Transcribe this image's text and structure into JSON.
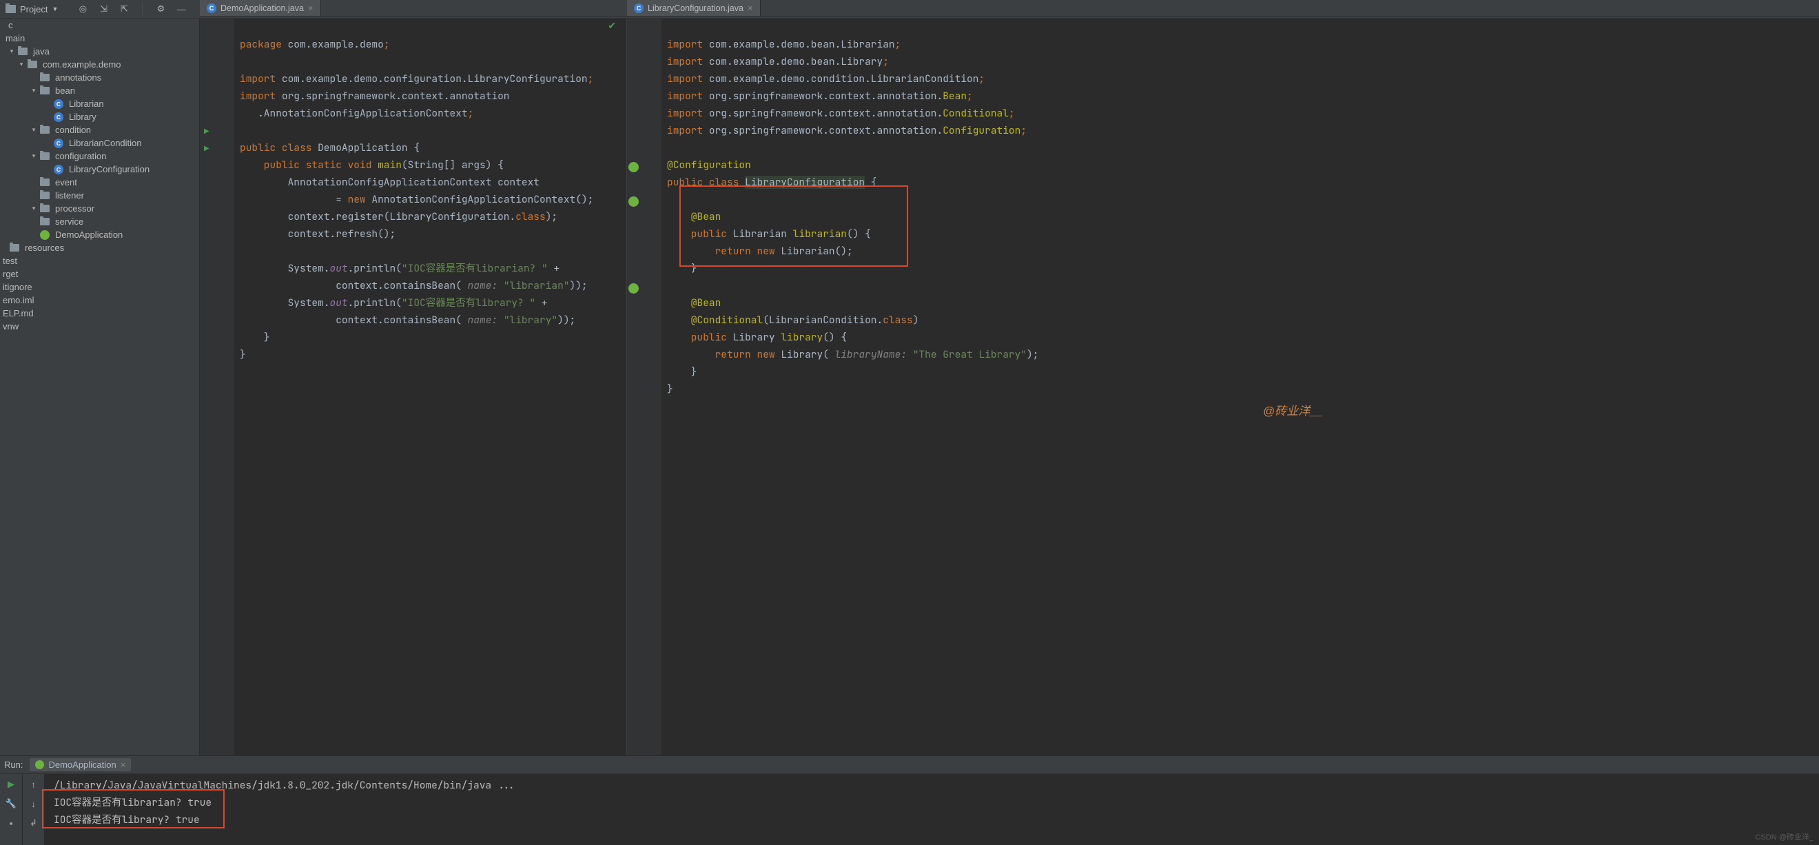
{
  "toolbar": {
    "project_label": "Project"
  },
  "tabs": {
    "left": {
      "label": "DemoApplication.java"
    },
    "right": {
      "label": "LibraryConfiguration.java"
    }
  },
  "tree": {
    "c": "c",
    "main": "main",
    "java": "java",
    "pkg": "com.example.demo",
    "annotations": "annotations",
    "bean": "bean",
    "librarian": "Librarian",
    "library": "Library",
    "condition": "condition",
    "librarian_condition": "LibrarianCondition",
    "configuration": "configuration",
    "library_configuration": "LibraryConfiguration",
    "event": "event",
    "listener": "listener",
    "processor": "processor",
    "service": "service",
    "demo_application": "DemoApplication",
    "resources": "resources",
    "test": "test",
    "rget": "rget",
    "itignore": "itignore",
    "emo_iml": "emo.iml",
    "elp_md": "ELP.md",
    "vnw": "vnw"
  },
  "code_left": {
    "l1a": "package ",
    "l1b": "com.example.demo",
    "l1c": ";",
    "l3a": "import ",
    "l3b": "com.example.demo.configuration.LibraryConfiguration",
    "l3c": ";",
    "l4a": "import ",
    "l4b": "org.springframework.context.annotation",
    "l5a": "   .AnnotationConfigApplicationContext",
    "l5b": ";",
    "l7a": "public class ",
    "l7b": "DemoApplication ",
    "l7c": "{",
    "l8a": "    public static void ",
    "l8b": "main",
    "l8c": "(String[] args) {",
    "l9": "        AnnotationConfigApplicationContext context",
    "l10a": "                = ",
    "l10b": "new ",
    "l10c": "AnnotationConfigApplicationContext();",
    "l11a": "        context.register(LibraryConfiguration.",
    "l11b": "class",
    "l11c": ");",
    "l12": "        context.refresh();",
    "l14a": "        System.",
    "l14b": "out",
    "l14c": ".println(",
    "l14d": "\"IOC容器是否有librarian? \"",
    "l14e": " +",
    "l15a": "                context.containsBean( ",
    "l15p": "name: ",
    "l15b": "\"librarian\"",
    "l15c": "));",
    "l16a": "        System.",
    "l16b": "out",
    "l16c": ".println(",
    "l16d": "\"IOC容器是否有library? \"",
    "l16e": " +",
    "l17a": "                context.containsBean( ",
    "l17p": "name: ",
    "l17b": "\"library\"",
    "l17c": "));",
    "l18": "    }",
    "l19": "}"
  },
  "code_right": {
    "l1a": "import ",
    "l1b": "com.example.demo.bean.Librarian",
    "l1c": ";",
    "l2a": "import ",
    "l2b": "com.example.demo.bean.Library",
    "l2c": ";",
    "l3a": "import ",
    "l3b": "com.example.demo.condition.LibrarianCondition",
    "l3c": ";",
    "l4a": "import ",
    "l4b": "org.springframework.context.annotation.",
    "l4c": "Bean",
    "l4d": ";",
    "l5a": "import ",
    "l5b": "org.springframework.context.annotation.",
    "l5c": "Conditional",
    "l5d": ";",
    "l6a": "import ",
    "l6b": "org.springframework.context.annotation.",
    "l6c": "Configuration",
    "l6d": ";",
    "l8": "@Configuration",
    "l9a": "public class ",
    "l9b": "LibraryConfiguration",
    "l9c": " {",
    "l11": "    @Bean",
    "l12a": "    public ",
    "l12b": "Librarian ",
    "l12c": "librarian",
    "l12d": "() {",
    "l13a": "        return new ",
    "l13b": "Librarian();",
    "l14": "    }",
    "l16": "    @Bean",
    "l17a": "    @Conditional",
    "l17b": "(LibrarianCondition.",
    "l17c": "class",
    "l17d": ")",
    "l18a": "    public ",
    "l18b": "Library ",
    "l18c": "library",
    "l18d": "() {",
    "l19a": "        return new ",
    "l19b": "Library( ",
    "l19p": "libraryName: ",
    "l19c": "\"The Great Library\"",
    "l19d": ");",
    "l20": "    }",
    "l21": "}"
  },
  "watermark": "@砖业洋__",
  "run": {
    "label": "Run:",
    "config": "DemoApplication",
    "out_cmd": "/Library/Java/JavaVirtualMachines/jdk1.8.0_202.jdk/Contents/Home/bin/java ...",
    "out_l1": "IOC容器是否有librarian? true",
    "out_l2": "IOC容器是否有library? true"
  },
  "footer": "CSDN @砖业洋_"
}
